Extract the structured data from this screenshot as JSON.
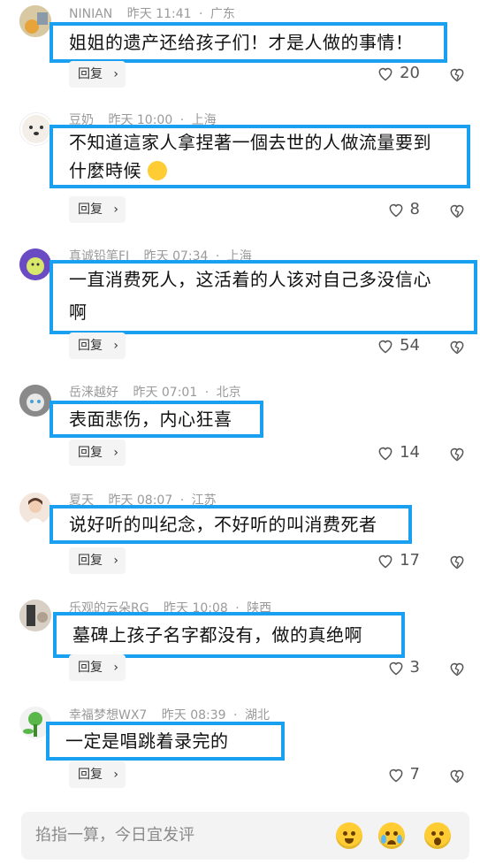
{
  "comments": [
    {
      "user": "NINIAN",
      "time": "昨天 11:41",
      "loc": "广东",
      "text_lines": [
        "姐姐的遗产还给孩子们！才是人做的事情！"
      ],
      "likes": "20",
      "reply": "回复"
    },
    {
      "user": "豆奶",
      "time": "昨天 10:00",
      "loc": "上海",
      "text_lines": [
        "不知道這家人拿捏著一個去世的人做流量要到",
        "什麼時候"
      ],
      "likes": "8",
      "reply": "回复",
      "emoji": "thinking-face"
    },
    {
      "user": "真诚铅笔FI",
      "time": "昨天 07:34",
      "loc": "上海",
      "text_lines": [
        "一直消费死人，这活着的人该对自己多没信心",
        "啊"
      ],
      "likes": "54",
      "reply": "回复"
    },
    {
      "user": "岳涞越好",
      "time": "昨天 07:01",
      "loc": "北京",
      "text_lines": [
        "表面悲伤，内心狂喜"
      ],
      "likes": "14",
      "reply": "回复"
    },
    {
      "user": "夏天",
      "time": "昨天 08:07",
      "loc": "江苏",
      "text_lines": [
        "说好听的叫纪念，不好听的叫消费死者"
      ],
      "likes": "17",
      "reply": "回复"
    },
    {
      "user": "乐观的云朵RG",
      "time": "昨天 10:08",
      "loc": "陕西",
      "text_lines": [
        "墓碑上孩子名字都没有，做的真绝啊"
      ],
      "likes": "3",
      "reply": "回复"
    },
    {
      "user": "幸福梦想WX7",
      "time": "昨天 08:39",
      "loc": "湖北",
      "text_lines": [
        "一定是唱跳着录完的"
      ],
      "likes": "7",
      "reply": "回复"
    }
  ],
  "input": {
    "placeholder": "掐指一算，今日宜发评"
  },
  "colors": {
    "highlight": "#1aa0f0",
    "meta": "#9a9a9a"
  },
  "icons": {
    "like": "heart-icon",
    "dislike": "broken-heart-icon",
    "reply_arrow": "chevron-right-icon"
  }
}
